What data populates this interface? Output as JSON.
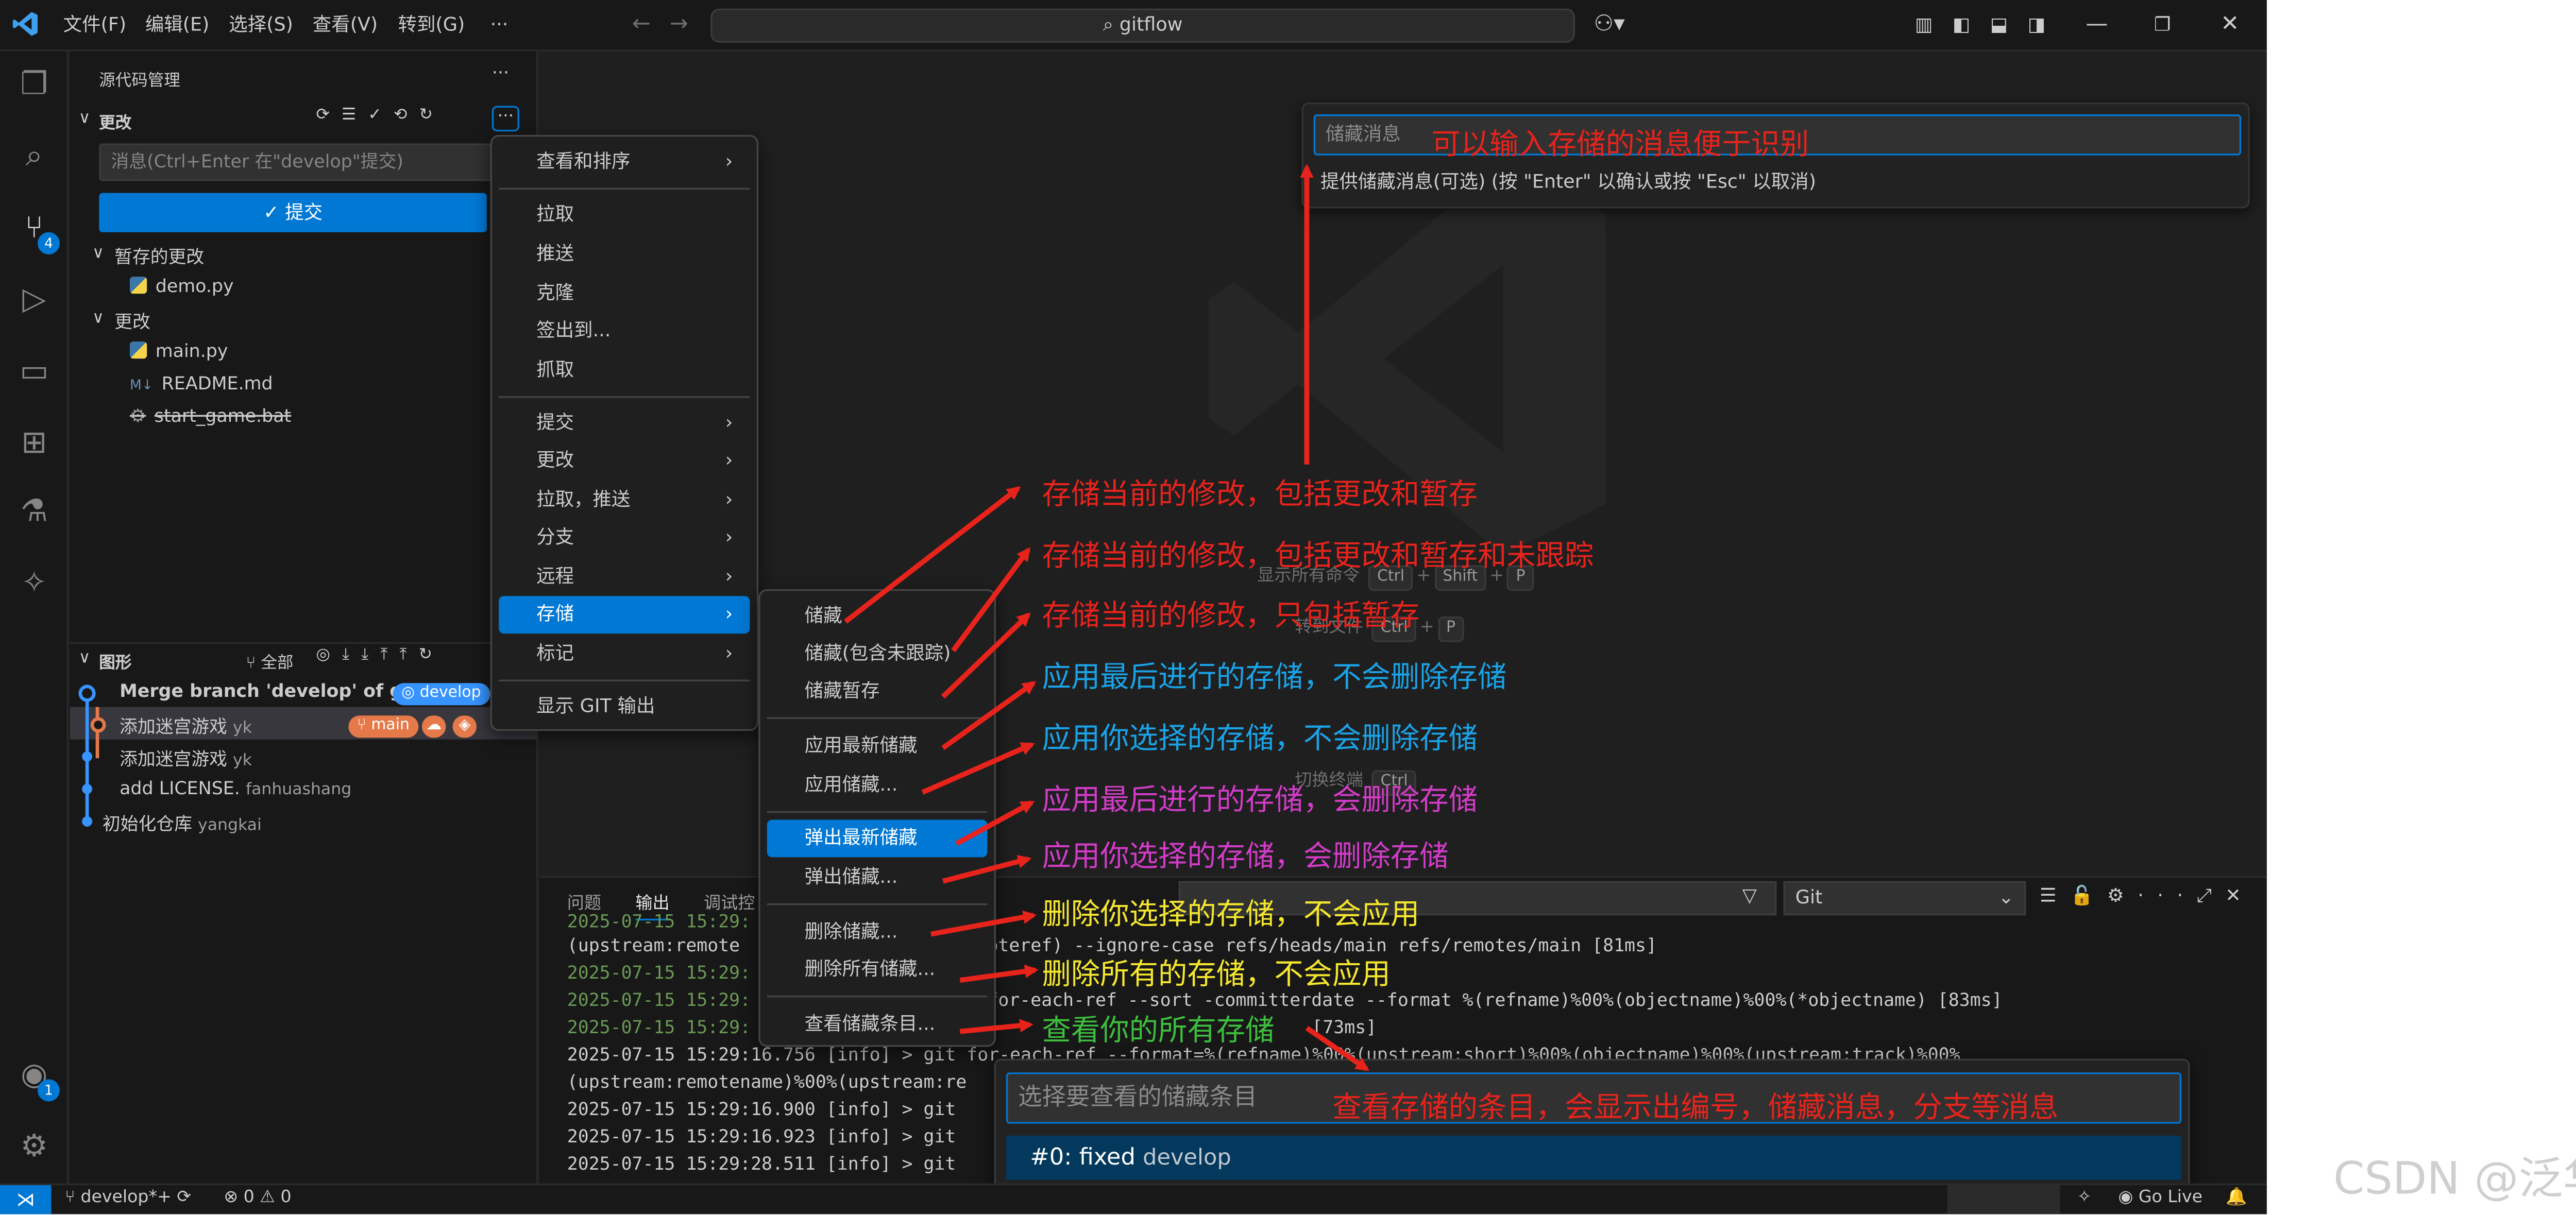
{
  "titlebar": {
    "menus": [
      "文件(F)",
      "编辑(E)",
      "选择(S)",
      "查看(V)",
      "转到(G)",
      "···"
    ],
    "search": "gitflow"
  },
  "activity": {
    "scm_badge": "4",
    "account_badge": "1"
  },
  "sidebar": {
    "title": "源代码管理",
    "title_more": "···",
    "changes_header": "更改",
    "message_placeholder": "消息(Ctrl+Enter 在\"develop\"提交)",
    "commit_label": "✓ 提交",
    "staged_header": "暂存的更改",
    "staged_files": [
      "demo.py"
    ],
    "changes_group": "更改",
    "changed_files": [
      "main.py",
      "README.md",
      "start_game.bat"
    ],
    "graph_header": "图形",
    "graph_all": "全部",
    "commits": [
      {
        "msg": "Merge branch 'develop' of gi...",
        "author": "",
        "tag": "develop"
      },
      {
        "msg": "添加迷宫游戏",
        "author": "yk",
        "tag": "main"
      },
      {
        "msg": "添加迷宫游戏",
        "author": "yk",
        "tag": ""
      },
      {
        "msg": "add LICENSE.",
        "author": "fanhuashang",
        "tag": ""
      },
      {
        "msg": "初始化仓库",
        "author": "yangkai",
        "tag": ""
      }
    ]
  },
  "menu1": {
    "items": [
      "查看和排序",
      "拉取",
      "推送",
      "克隆",
      "签出到...",
      "抓取",
      "提交",
      "更改",
      "拉取，推送",
      "分支",
      "远程",
      "存储",
      "标记",
      "显示 GIT 输出"
    ],
    "arrow": "›"
  },
  "menu2": {
    "items": [
      "储藏",
      "储藏(包含未跟踪)",
      "储藏暂存",
      "应用最新储藏",
      "应用储藏...",
      "弹出最新储藏",
      "弹出储藏...",
      "删除储藏...",
      "删除所有储藏...",
      "查看储藏条目..."
    ]
  },
  "stash_input": {
    "placeholder": "储藏消息",
    "help": "提供储藏消息(可选) (按 \"Enter\" 以确认或按 \"Esc\" 以取消)"
  },
  "editor_hints": {
    "show_commands": "显示所有命令",
    "show_keys": [
      "Ctrl",
      "Shift",
      "P"
    ],
    "goto_file": "转到文件",
    "goto_keys": [
      "Ctrl",
      "P"
    ],
    "toggle_terminal": "切换终端",
    "toggle_keys": [
      "Ctrl"
    ]
  },
  "panel": {
    "tabs": [
      "问题",
      "输出",
      "调试控"
    ],
    "git_select": "Git",
    "logs": [
      "2025-07-15 15:29:",
      "(upstream:remote",
      "2025-07-15 15:29:",
      "2025-07-15 15:29:",
      "2025-07-15 15:29:",
      "2025-07-15 15:29:16.756 [info] > git for-each-ref --format=%(refname)%00%(upstream:short)%00%(objectname)%00%(upstream:track)%00%",
      "(upstream:remotename)%00%(upstream:re",
      "2025-07-15 15:29:16.900 [info] > git",
      "2025-07-15 15:29:16.923 [info] > git",
      "2025-07-15 15:29:28.511 [info] > git"
    ],
    "log_tails": [
      "oteref) --ignore-case refs/heads/main refs/remotes/main [81ms]",
      "for-each-ref --sort -committerdate --format %(refname)%00%(objectname)%00%(*objectname) [83ms]",
      "[73ms]"
    ]
  },
  "quickpick": {
    "placeholder": "选择要查看的储藏条目",
    "item": "#0: fixed",
    "item_branch": "develop"
  },
  "statusbar": {
    "branch": "develop*+",
    "problems": "⊗ 0 ⚠ 0",
    "right": "Go Live"
  },
  "annotations": {
    "stash_msg": "可以输入存储的消息便于识别",
    "a1": "存储当前的修改，包括更改和暂存",
    "a2": "存储当前的修改，包括更改和暂存和未跟踪",
    "a3": "存储当前的修改，只包括暂存",
    "a4": "应用最后进行的存储，不会删除存储",
    "a5": "应用你选择的存储，不会删除存储",
    "a6": "应用最后进行的存储，会删除存储",
    "a7": "应用你选择的存储，会删除存储",
    "a8": "删除你选择的存储，不会应用",
    "a9": "删除所有的存储，不会应用",
    "a10": "查看你的所有存储",
    "a11": "查看存储的条目，会显示出编号，储藏消息，分支等消息"
  },
  "watermark": "CSDN @泛华赏",
  "colors": {
    "accent": "#0078d4",
    "anno_red": "#e8231c",
    "anno_blue": "#1aa3e8",
    "anno_magenta": "#d23cc8",
    "anno_yellow": "#f5e72e",
    "anno_green": "#3dbf3d"
  }
}
